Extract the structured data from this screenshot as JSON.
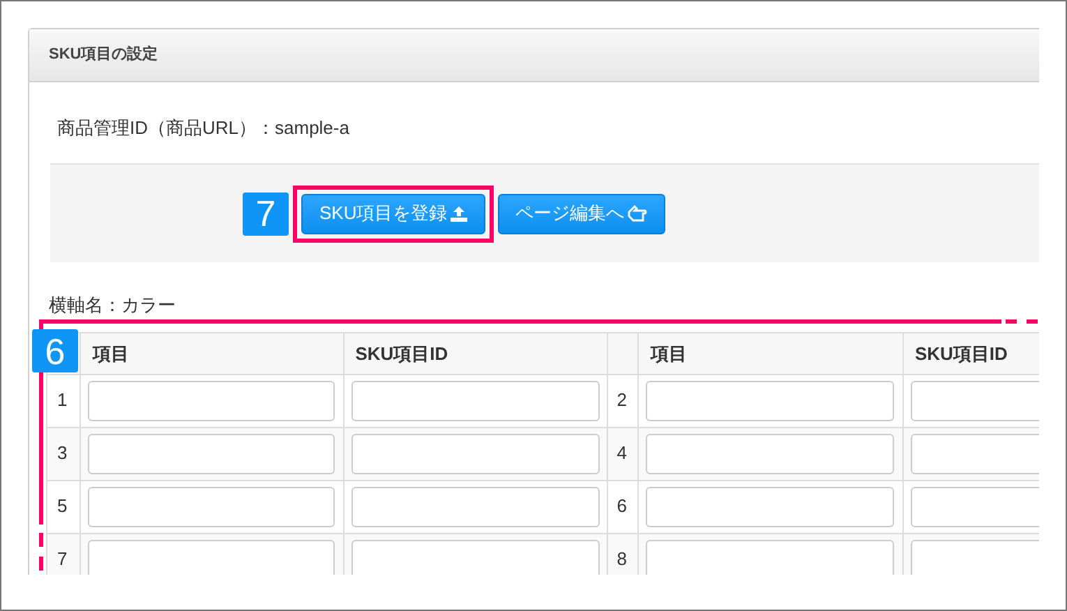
{
  "panel": {
    "title": "SKU項目の設定"
  },
  "product_line": "商品管理ID（商品URL）：sample-a",
  "step_badges": [
    {
      "label": "7"
    },
    {
      "label": "6"
    }
  ],
  "buttons": [
    {
      "label": "SKU項目を登録",
      "highlighted": true
    },
    {
      "label": "ページ編集へ",
      "highlighted": false
    }
  ],
  "axis_label": "横軸名：カラー",
  "table": {
    "columns": [
      "項目",
      "SKU項目ID",
      "項目",
      "SKU項目ID"
    ],
    "rows": [
      {
        "left_no": "1",
        "right_no": "2"
      },
      {
        "left_no": "3",
        "right_no": "4"
      },
      {
        "left_no": "5",
        "right_no": "6"
      },
      {
        "left_no": "7",
        "right_no": "8"
      }
    ]
  }
}
